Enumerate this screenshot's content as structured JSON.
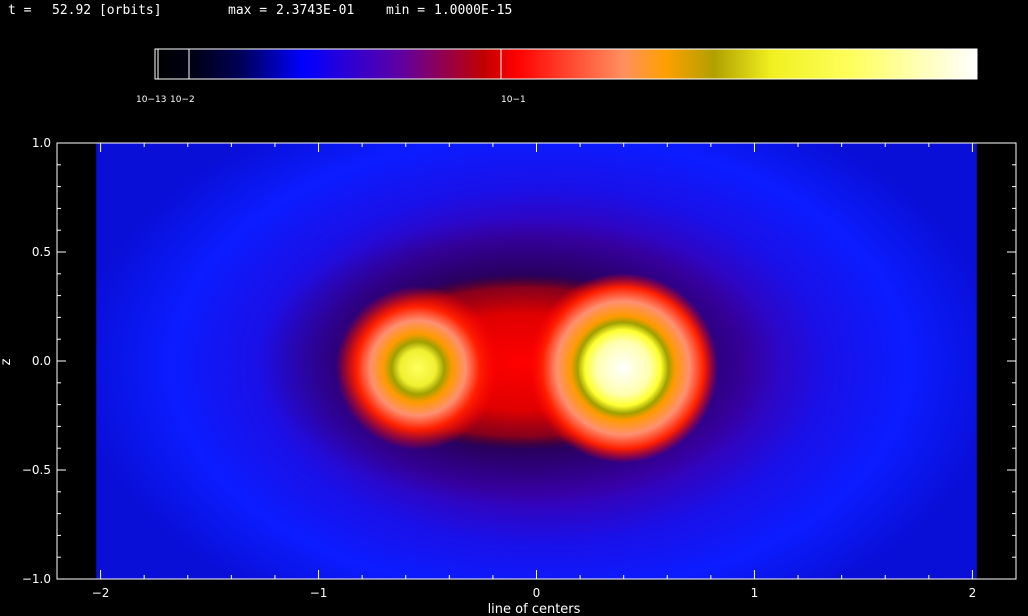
{
  "header": {
    "time_label": "t =",
    "time_value": "52.92 [orbits]",
    "max_label": "max =",
    "max_value": "2.3743E-01",
    "min_label": "min =",
    "min_value": "1.0000E-15"
  },
  "colorbar": {
    "tick_labels": [
      "10−13",
      "10−2",
      "10−1"
    ],
    "colors": [
      "#000000",
      "#000040",
      "#0000ff",
      "#7a0080",
      "#ff0000",
      "#ffa060",
      "#c0c000",
      "#ffff40",
      "#ffffff"
    ]
  },
  "chart_data": {
    "type": "heatmap",
    "title": "",
    "xlabel": "line of centers",
    "ylabel": "z",
    "xlim": [
      -2.2,
      2.2
    ],
    "ylim": [
      -1.0,
      1.0
    ],
    "x_ticks": [
      -2,
      -1,
      0,
      1,
      2
    ],
    "x_tick_labels": [
      "−2",
      "−1",
      "0",
      "1",
      "2"
    ],
    "y_ticks": [
      -1.0,
      -0.5,
      0.0,
      0.5,
      1.0
    ],
    "y_tick_labels": [
      "−1.0",
      "−0.5",
      "0.0",
      "0.5",
      "1.0"
    ],
    "data_extent_x": [
      -2.02,
      2.02
    ],
    "max": 0.23743,
    "min": 1e-15,
    "sources": [
      {
        "x": -0.55,
        "z": -0.05,
        "peak_level": "yellow"
      },
      {
        "x": 0.4,
        "z": -0.04,
        "peak_level": "white"
      }
    ],
    "grid": false
  }
}
